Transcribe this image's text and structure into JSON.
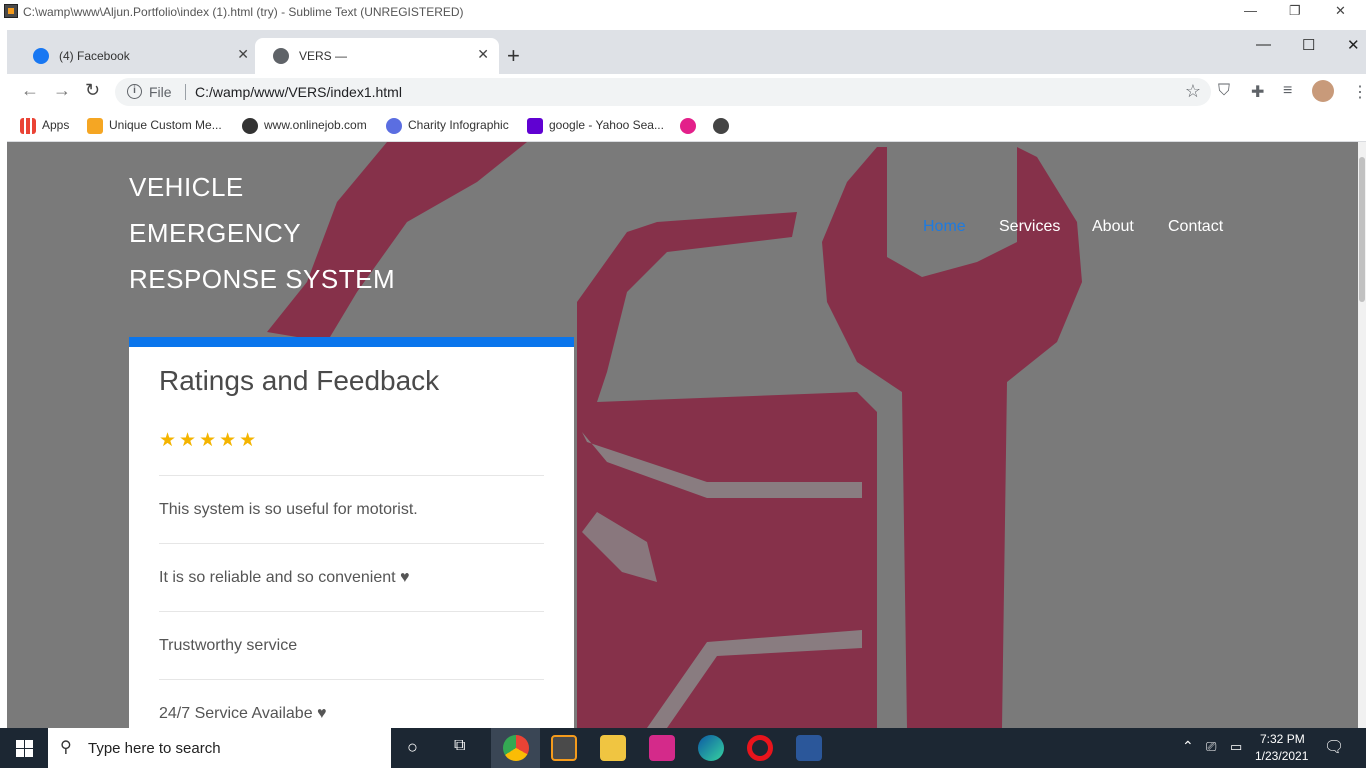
{
  "sublime": {
    "title": "C:\\wamp\\www\\Aljun.Portfolio\\index (1).html (try) - Sublime Text (UNREGISTERED)"
  },
  "chrome": {
    "tabs": [
      {
        "label": "(4) Facebook",
        "icon": "facebook-icon"
      },
      {
        "label": "VERS —",
        "icon": "globe-icon"
      }
    ],
    "address": {
      "scheme": "File",
      "url": "C:/wamp/www/VERS/index1.html"
    },
    "bookmarks": [
      "Apps",
      "Unique Custom Me...",
      "www.onlinejob.com",
      "Charity Infographic",
      "google - Yahoo Sea..."
    ]
  },
  "page": {
    "brand_lines": [
      "VEHICLE",
      "EMERGENCY",
      "RESPONSE SYSTEM"
    ],
    "nav": [
      "Home",
      "Services",
      "About",
      "Contact"
    ],
    "card": {
      "title": "Ratings and Feedback",
      "stars": "★★★★★",
      "star_rating": 5,
      "feedback": [
        "This system is so useful for motorist.",
        "It is so reliable and so convenient ♥",
        "Trustworthy service",
        "24/7 Service Availabe ♥"
      ]
    },
    "colors": {
      "accent": "#0a75ec",
      "nav_active": "#1e7be0",
      "art": "#8b1538",
      "overlay": "#7a7a7a",
      "stars": "#f4b400"
    }
  },
  "taskbar": {
    "search_placeholder": "Type here to search",
    "time": "7:32 PM",
    "date": "1/23/2021"
  }
}
